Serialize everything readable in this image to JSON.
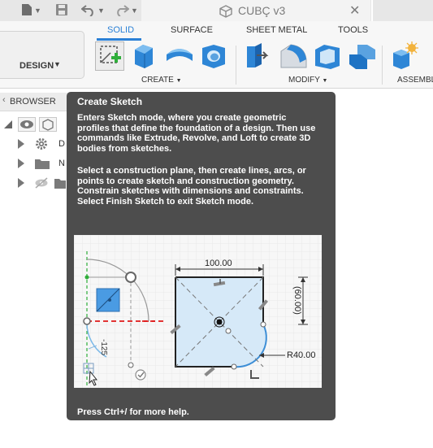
{
  "top_bar": {
    "icons": [
      "file-icon",
      "save-icon",
      "undo-icon",
      "redo-icon"
    ],
    "document_title": "CUBÇ v3",
    "close_glyph": "✕"
  },
  "toolbar": {
    "workspace_label": "DESIGN",
    "tabs": [
      "SOLID",
      "SURFACE",
      "SHEET METAL",
      "TOOLS"
    ],
    "active_tab": "SOLID",
    "groups": [
      {
        "label": "CREATE",
        "caret": "▼"
      },
      {
        "label": "MODIFY",
        "caret": "▼"
      },
      {
        "label": "ASSEMBL"
      }
    ],
    "tools": [
      "create-sketch",
      "extrude",
      "revolve",
      "hole",
      "press-pull",
      "fillet",
      "shell",
      "combine",
      "new-component"
    ],
    "accent_color": "#2b80d6"
  },
  "browser": {
    "label": "BROWSER",
    "items": [
      {
        "icon": "eye-icon",
        "label": ""
      },
      {
        "icon": "gear-icon",
        "label": "D"
      },
      {
        "icon": "folder-icon",
        "label": "N"
      },
      {
        "icon": "folder-icon",
        "label": ""
      }
    ]
  },
  "tooltip": {
    "title": "Create Sketch",
    "paragraph1": "Enters Sketch mode, where you create geometric profiles that define the foundation of a design. Then use commands like Extrude, Revolve, and Loft to create 3D bodies from sketches.",
    "paragraph2": "Select a construction plane, then create lines, arcs, or points to create sketch and construction geometry. Constrain sketches with dimensions and constraints. Select Finish Sketch to exit Sketch mode.",
    "footer": "Press Ctrl+/ for more help.",
    "background": "#4d4d4d",
    "illustration": {
      "dimension_width": "100.00",
      "dimension_height": "(60.00)",
      "dimension_radius": "R40.00",
      "dimension_side": "-125"
    }
  }
}
